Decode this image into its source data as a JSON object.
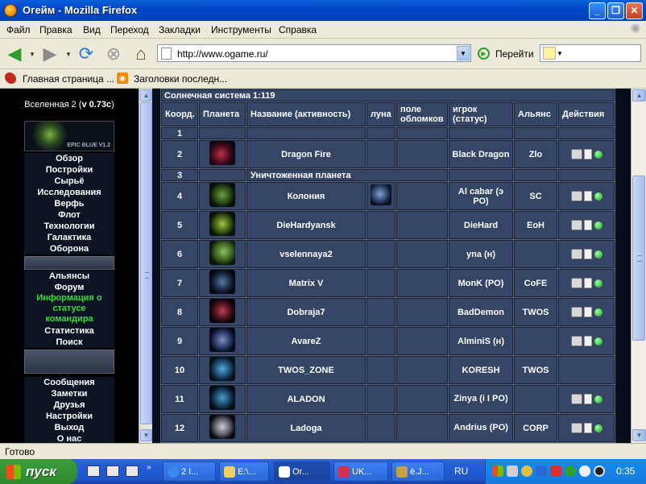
{
  "window": {
    "title": "Огейм - Mozilla Firefox",
    "min": "_",
    "max": "❐",
    "close": "✕"
  },
  "menubar": [
    "Файл",
    "Правка",
    "Вид",
    "Переход",
    "Закладки",
    "Инструменты",
    "Справка"
  ],
  "navbar": {
    "url": "http://www.ogame.ru/",
    "go_label": "Перейти"
  },
  "bookmarks": [
    "Главная страница ...",
    "Заголовки последн..."
  ],
  "left": {
    "universe_label": "Вселенная 2 (",
    "universe_version": "v 0.73c",
    "universe_suffix": ")",
    "logo_text": "EPIC BLUE V1.2",
    "menu1": [
      "Обзор",
      "Постройки",
      "Сырьё",
      "Исследования",
      "Верфь",
      "Флот",
      "Технологии",
      "Галактика",
      "Оборона"
    ],
    "menu2": [
      "Альянсы",
      "Форум"
    ],
    "commander": "Информация о статусе командира",
    "menu3": [
      "Статистика",
      "Поиск"
    ],
    "menu4": [
      "Сообщения",
      "Заметки",
      "Друзья",
      "Настройки",
      "Выход",
      "О нас"
    ]
  },
  "galaxy": {
    "system_title": "Солнечная система 1:119",
    "headers": [
      "Коорд.",
      "Планета",
      "Название (активность)",
      "луна",
      "поле обломков",
      "игрок (статус)",
      "Альянс",
      "Действия"
    ],
    "destroyed": "Уничтоженная планета",
    "rows": [
      {
        "pos": "1",
        "name": "",
        "moon": false,
        "player": "",
        "alliance": "",
        "actions": false
      },
      {
        "pos": "2",
        "name": "Dragon Fire",
        "moon": false,
        "player": "Black Dragon",
        "alliance": "Zlo",
        "actions": true
      },
      {
        "pos": "3",
        "destroyed": true
      },
      {
        "pos": "4",
        "name": "Колония",
        "moon": true,
        "player": "Al cabar (э РО)",
        "alliance": "SC",
        "actions": true
      },
      {
        "pos": "5",
        "name": "DieHardyansk",
        "moon": false,
        "player": "DieHard",
        "alliance": "EoH",
        "actions": true
      },
      {
        "pos": "6",
        "name": "vselennaya2",
        "moon": false,
        "player": "yna (н)",
        "alliance": "",
        "actions": true
      },
      {
        "pos": "7",
        "name": "Matrix V",
        "moon": false,
        "player": "MonK (PO)",
        "alliance": "CoFE",
        "actions": true
      },
      {
        "pos": "8",
        "name": "Dobraja7",
        "moon": false,
        "player": "BadDemon",
        "alliance": "TWOS",
        "actions": true
      },
      {
        "pos": "9",
        "name": "AvareZ",
        "moon": false,
        "player": "AlminiS (н)",
        "alliance": "",
        "actions": true
      },
      {
        "pos": "10",
        "name": "TWOS_ZONE",
        "moon": false,
        "player": "KORESH",
        "alliance": "TWOS",
        "actions": false
      },
      {
        "pos": "11",
        "name": "ALADON",
        "moon": false,
        "player": "Zinya (i I PO)",
        "alliance": "",
        "actions": true
      },
      {
        "pos": "12",
        "name": "Ladoga",
        "moon": false,
        "player": "Andrius (PO)",
        "alliance": "CORP",
        "actions": true
      }
    ]
  },
  "status": "Готово",
  "taskbar": {
    "start": "пуск",
    "buttons": [
      "2 I...",
      "E:\\...",
      "Or...",
      "UK...",
      "ё.J..."
    ],
    "lang": "RU",
    "clock": "0:35"
  },
  "colors": {
    "table_bg": "#344566",
    "accent_green": "#39ff39",
    "player_link": "#8ec3ff"
  }
}
